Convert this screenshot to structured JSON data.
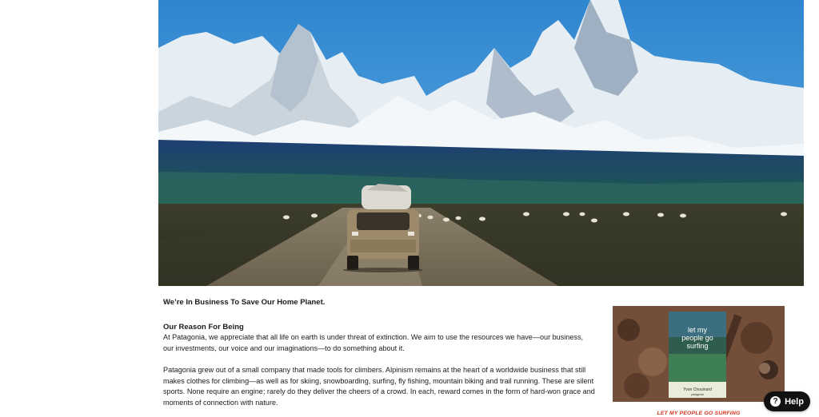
{
  "hero": {
    "image_alt": "Car driving on a gravel road toward snow-capped Fitz Roy mountains"
  },
  "mission": {
    "heading": "We’re In Business To Save Our Home Planet."
  },
  "reason": {
    "title": "Our Reason For Being",
    "paragraph1": "At Patagonia, we appreciate that all life on earth is under threat of extinction. We aim to use the resources we have—our business, our investments, our voice and our imaginations—to do something about it.",
    "paragraph2": "Patagonia grew out of a small company that made tools for climbers. Alpinism remains at the heart of a worldwide business that still makes clothes for climbing—as well as for skiing, snowboarding, surfing, fly fishing, mountain biking and trail running. These are silent sports. None require an engine; rarely do they deliver the cheers of a crowd. In each, reward comes in the form of hard-won grace and moments of connection with nature."
  },
  "book": {
    "title": "let my people go surfing",
    "subtitle": "The Education of a Reluctant Businessman",
    "author": "Yvon Chouinard",
    "publisher": "patagonia",
    "link_label": "LET MY PEOPLE GO SURFING"
  },
  "help": {
    "label": "Help",
    "icon_glyph": "?"
  },
  "colors": {
    "accent": "#d4331d",
    "help_bg": "#111111"
  }
}
